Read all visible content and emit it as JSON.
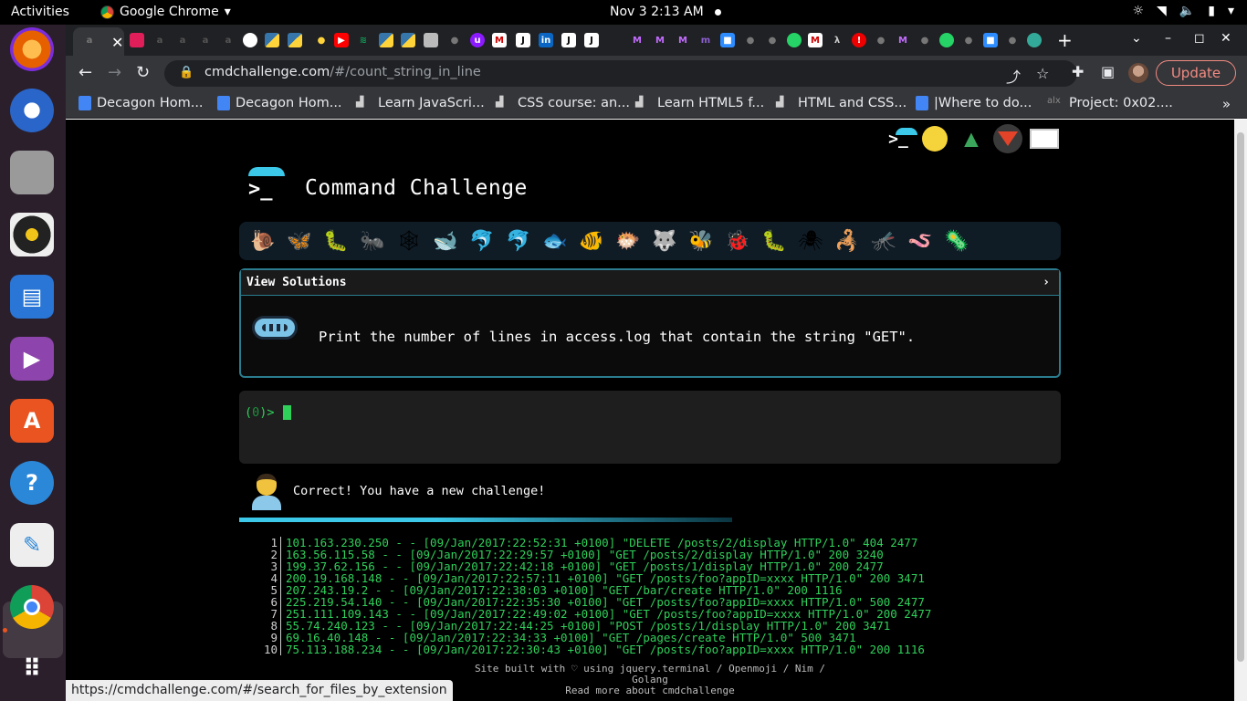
{
  "system": {
    "activities": "Activities",
    "app_name": "Google Chrome",
    "clock": "Nov 3  2:13 AM"
  },
  "dock": [
    {
      "name": "firefox",
      "color": "#e66000"
    },
    {
      "name": "thunderbird",
      "color": "#2a66c9"
    },
    {
      "name": "files",
      "color": "#a7a7a7"
    },
    {
      "name": "rhythmbox",
      "color": "#f0c419"
    },
    {
      "name": "writer",
      "color": "#2a76d6"
    },
    {
      "name": "videos",
      "color": "#8e44ad"
    },
    {
      "name": "software",
      "color": "#e95420"
    },
    {
      "name": "help",
      "color": "#2b87d8"
    },
    {
      "name": "text-editor",
      "color": "#eeeeee"
    },
    {
      "name": "chrome",
      "color": "#db4437"
    },
    {
      "name": "show-apps",
      "color": "#ffffff"
    }
  ],
  "browser": {
    "url_host": "cmdchallenge.com",
    "url_path": "/#/count_string_in_line",
    "update_label": "Update",
    "bookmarks": [
      {
        "label": "Decagon Hom...",
        "icon": "doc"
      },
      {
        "label": "Decagon Hom...",
        "icon": "doc"
      },
      {
        "label": "Learn JavaScri...",
        "icon": "fcc"
      },
      {
        "label": "CSS course: an...",
        "icon": "fcc"
      },
      {
        "label": "Learn HTML5 f...",
        "icon": "fcc"
      },
      {
        "label": "HTML and CSS...",
        "icon": "fcc"
      },
      {
        "label": "|Where to do...",
        "icon": "doc"
      },
      {
        "label": "Project: 0x02....",
        "icon": "alx"
      }
    ],
    "more_bookmarks": "»",
    "status_url": "https://cmdchallenge.com/#/search_for_files_by_extension"
  },
  "page": {
    "title": "Command Challenge",
    "view_solutions": "View Solutions",
    "chevron": "›",
    "task": "Print the number of lines in access.log that contain the string \"GET\".",
    "prompt_prefix": "(",
    "prompt_count": "0",
    "prompt_suffix": ")>",
    "correct_message": "Correct! You have a new challenge!",
    "progress_fraction": 0.4,
    "level_icons": [
      "🐌",
      "🦋",
      "🐛",
      "🐜",
      "🕸",
      "🐋",
      "🐬",
      "🐬",
      "🐟",
      "🐠",
      "🐡",
      "🐺",
      "🐝",
      "🐞",
      "🐛",
      "🕷",
      "🦂",
      "🦟",
      "🪱",
      "🦠"
    ],
    "log_lines": [
      {
        "n": "1",
        "text": "101.163.230.250 - - [09/Jan/2017:22:52:31 +0100] \"DELETE /posts/2/display HTTP/1.0\" 404 2477"
      },
      {
        "n": "2",
        "text": "163.56.115.58 - - [09/Jan/2017:22:29:57 +0100] \"GET /posts/2/display HTTP/1.0\" 200 3240"
      },
      {
        "n": "3",
        "text": "199.37.62.156 - - [09/Jan/2017:22:42:18 +0100] \"GET /posts/1/display HTTP/1.0\" 200 2477"
      },
      {
        "n": "4",
        "text": "200.19.168.148 - - [09/Jan/2017:22:57:11 +0100] \"GET /posts/foo?appID=xxxx HTTP/1.0\" 200 3471"
      },
      {
        "n": "5",
        "text": "207.243.19.2 - - [09/Jan/2017:22:38:03 +0100] \"GET /bar/create HTTP/1.0\" 200 1116"
      },
      {
        "n": "6",
        "text": "225.219.54.140 - - [09/Jan/2017:22:35:30 +0100] \"GET /posts/foo?appID=xxxx HTTP/1.0\" 500 2477"
      },
      {
        "n": "7",
        "text": "251.111.109.143 - - [09/Jan/2017:22:49:02 +0100] \"GET /posts/foo?appID=xxxx HTTP/1.0\" 200 2477"
      },
      {
        "n": "8",
        "text": "55.74.240.123 - - [09/Jan/2017:22:44:25 +0100] \"POST /posts/1/display HTTP/1.0\" 200 3471"
      },
      {
        "n": "9",
        "text": "69.16.40.148 - - [09/Jan/2017:22:34:33 +0100] \"GET /pages/create HTTP/1.0\" 500 3471"
      },
      {
        "n": "10",
        "text": "75.113.188.234 - - [09/Jan/2017:22:30:43 +0100] \"GET /posts/foo?appID=xxxx HTTP/1.0\" 200 1116"
      }
    ],
    "footer_line1": "Site built with ♡ using jquery.terminal / Openmoji / Nim / Golang",
    "footer_line2": "Read more about cmdchallenge"
  },
  "colors": {
    "accent": "#3cc8e8",
    "terminal_green": "#2fd05a",
    "panel_border": "#2a7c8e"
  }
}
